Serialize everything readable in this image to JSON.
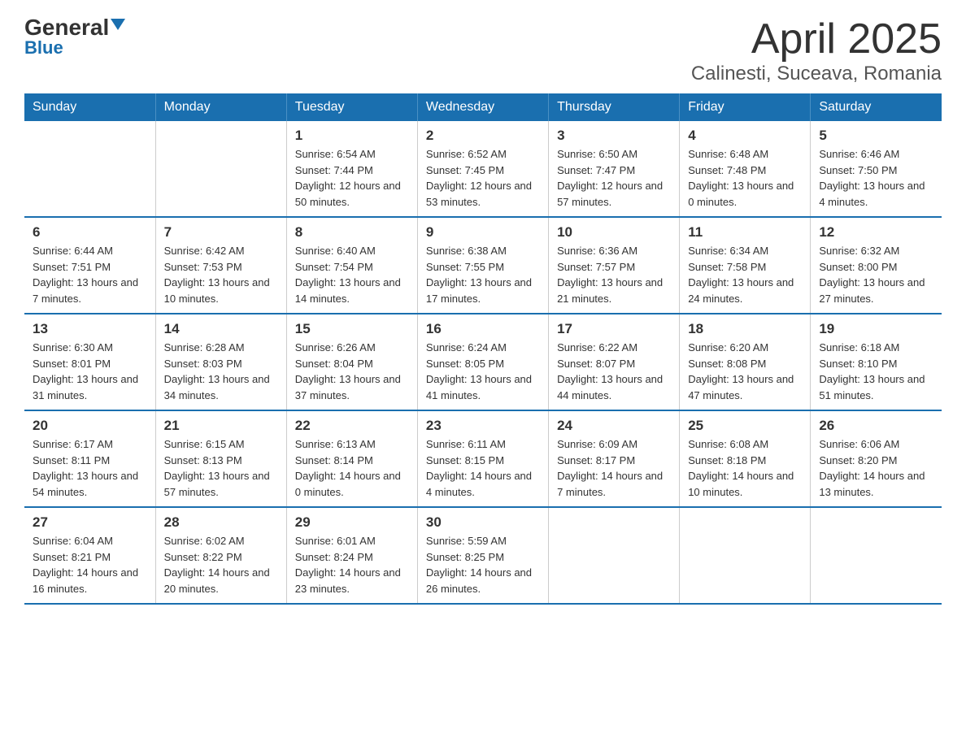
{
  "logo": {
    "text_general": "General",
    "text_blue": "Blue"
  },
  "title": "April 2025",
  "subtitle": "Calinesti, Suceava, Romania",
  "weekdays": [
    "Sunday",
    "Monday",
    "Tuesday",
    "Wednesday",
    "Thursday",
    "Friday",
    "Saturday"
  ],
  "weeks": [
    [
      {
        "day": "",
        "sunrise": "",
        "sunset": "",
        "daylight": ""
      },
      {
        "day": "",
        "sunrise": "",
        "sunset": "",
        "daylight": ""
      },
      {
        "day": "1",
        "sunrise": "Sunrise: 6:54 AM",
        "sunset": "Sunset: 7:44 PM",
        "daylight": "Daylight: 12 hours and 50 minutes."
      },
      {
        "day": "2",
        "sunrise": "Sunrise: 6:52 AM",
        "sunset": "Sunset: 7:45 PM",
        "daylight": "Daylight: 12 hours and 53 minutes."
      },
      {
        "day": "3",
        "sunrise": "Sunrise: 6:50 AM",
        "sunset": "Sunset: 7:47 PM",
        "daylight": "Daylight: 12 hours and 57 minutes."
      },
      {
        "day": "4",
        "sunrise": "Sunrise: 6:48 AM",
        "sunset": "Sunset: 7:48 PM",
        "daylight": "Daylight: 13 hours and 0 minutes."
      },
      {
        "day": "5",
        "sunrise": "Sunrise: 6:46 AM",
        "sunset": "Sunset: 7:50 PM",
        "daylight": "Daylight: 13 hours and 4 minutes."
      }
    ],
    [
      {
        "day": "6",
        "sunrise": "Sunrise: 6:44 AM",
        "sunset": "Sunset: 7:51 PM",
        "daylight": "Daylight: 13 hours and 7 minutes."
      },
      {
        "day": "7",
        "sunrise": "Sunrise: 6:42 AM",
        "sunset": "Sunset: 7:53 PM",
        "daylight": "Daylight: 13 hours and 10 minutes."
      },
      {
        "day": "8",
        "sunrise": "Sunrise: 6:40 AM",
        "sunset": "Sunset: 7:54 PM",
        "daylight": "Daylight: 13 hours and 14 minutes."
      },
      {
        "day": "9",
        "sunrise": "Sunrise: 6:38 AM",
        "sunset": "Sunset: 7:55 PM",
        "daylight": "Daylight: 13 hours and 17 minutes."
      },
      {
        "day": "10",
        "sunrise": "Sunrise: 6:36 AM",
        "sunset": "Sunset: 7:57 PM",
        "daylight": "Daylight: 13 hours and 21 minutes."
      },
      {
        "day": "11",
        "sunrise": "Sunrise: 6:34 AM",
        "sunset": "Sunset: 7:58 PM",
        "daylight": "Daylight: 13 hours and 24 minutes."
      },
      {
        "day": "12",
        "sunrise": "Sunrise: 6:32 AM",
        "sunset": "Sunset: 8:00 PM",
        "daylight": "Daylight: 13 hours and 27 minutes."
      }
    ],
    [
      {
        "day": "13",
        "sunrise": "Sunrise: 6:30 AM",
        "sunset": "Sunset: 8:01 PM",
        "daylight": "Daylight: 13 hours and 31 minutes."
      },
      {
        "day": "14",
        "sunrise": "Sunrise: 6:28 AM",
        "sunset": "Sunset: 8:03 PM",
        "daylight": "Daylight: 13 hours and 34 minutes."
      },
      {
        "day": "15",
        "sunrise": "Sunrise: 6:26 AM",
        "sunset": "Sunset: 8:04 PM",
        "daylight": "Daylight: 13 hours and 37 minutes."
      },
      {
        "day": "16",
        "sunrise": "Sunrise: 6:24 AM",
        "sunset": "Sunset: 8:05 PM",
        "daylight": "Daylight: 13 hours and 41 minutes."
      },
      {
        "day": "17",
        "sunrise": "Sunrise: 6:22 AM",
        "sunset": "Sunset: 8:07 PM",
        "daylight": "Daylight: 13 hours and 44 minutes."
      },
      {
        "day": "18",
        "sunrise": "Sunrise: 6:20 AM",
        "sunset": "Sunset: 8:08 PM",
        "daylight": "Daylight: 13 hours and 47 minutes."
      },
      {
        "day": "19",
        "sunrise": "Sunrise: 6:18 AM",
        "sunset": "Sunset: 8:10 PM",
        "daylight": "Daylight: 13 hours and 51 minutes."
      }
    ],
    [
      {
        "day": "20",
        "sunrise": "Sunrise: 6:17 AM",
        "sunset": "Sunset: 8:11 PM",
        "daylight": "Daylight: 13 hours and 54 minutes."
      },
      {
        "day": "21",
        "sunrise": "Sunrise: 6:15 AM",
        "sunset": "Sunset: 8:13 PM",
        "daylight": "Daylight: 13 hours and 57 minutes."
      },
      {
        "day": "22",
        "sunrise": "Sunrise: 6:13 AM",
        "sunset": "Sunset: 8:14 PM",
        "daylight": "Daylight: 14 hours and 0 minutes."
      },
      {
        "day": "23",
        "sunrise": "Sunrise: 6:11 AM",
        "sunset": "Sunset: 8:15 PM",
        "daylight": "Daylight: 14 hours and 4 minutes."
      },
      {
        "day": "24",
        "sunrise": "Sunrise: 6:09 AM",
        "sunset": "Sunset: 8:17 PM",
        "daylight": "Daylight: 14 hours and 7 minutes."
      },
      {
        "day": "25",
        "sunrise": "Sunrise: 6:08 AM",
        "sunset": "Sunset: 8:18 PM",
        "daylight": "Daylight: 14 hours and 10 minutes."
      },
      {
        "day": "26",
        "sunrise": "Sunrise: 6:06 AM",
        "sunset": "Sunset: 8:20 PM",
        "daylight": "Daylight: 14 hours and 13 minutes."
      }
    ],
    [
      {
        "day": "27",
        "sunrise": "Sunrise: 6:04 AM",
        "sunset": "Sunset: 8:21 PM",
        "daylight": "Daylight: 14 hours and 16 minutes."
      },
      {
        "day": "28",
        "sunrise": "Sunrise: 6:02 AM",
        "sunset": "Sunset: 8:22 PM",
        "daylight": "Daylight: 14 hours and 20 minutes."
      },
      {
        "day": "29",
        "sunrise": "Sunrise: 6:01 AM",
        "sunset": "Sunset: 8:24 PM",
        "daylight": "Daylight: 14 hours and 23 minutes."
      },
      {
        "day": "30",
        "sunrise": "Sunrise: 5:59 AM",
        "sunset": "Sunset: 8:25 PM",
        "daylight": "Daylight: 14 hours and 26 minutes."
      },
      {
        "day": "",
        "sunrise": "",
        "sunset": "",
        "daylight": ""
      },
      {
        "day": "",
        "sunrise": "",
        "sunset": "",
        "daylight": ""
      },
      {
        "day": "",
        "sunrise": "",
        "sunset": "",
        "daylight": ""
      }
    ]
  ]
}
